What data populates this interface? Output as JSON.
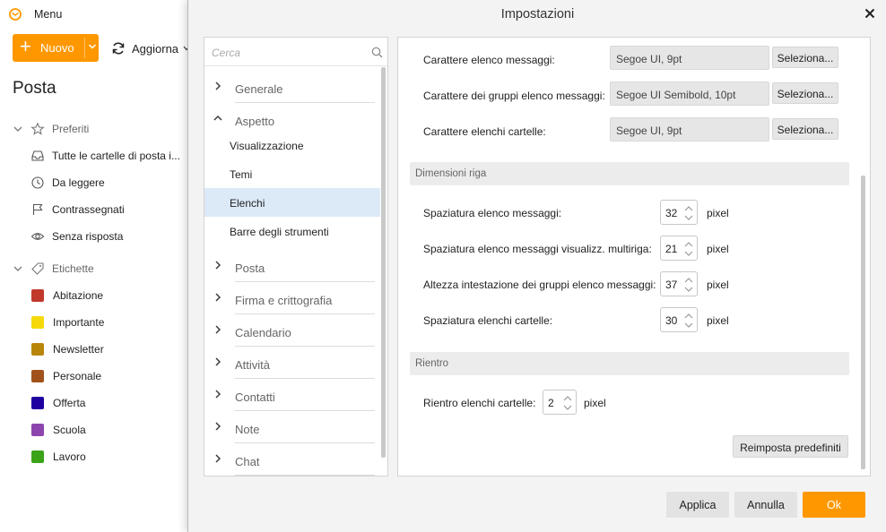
{
  "app": {
    "menu_label": "Menu",
    "nuovo_label": "Nuovo",
    "aggiorna_label": "Aggiorna",
    "title": "Posta",
    "sections": {
      "preferiti": {
        "label": "Preferiti",
        "items": [
          {
            "label": "Tutte le cartelle di posta i...",
            "icon": "inbox-icon"
          },
          {
            "label": "Da leggere",
            "icon": "clock-icon"
          },
          {
            "label": "Contrassegnati",
            "icon": "flag-icon"
          },
          {
            "label": "Senza risposta",
            "icon": "eye-icon"
          }
        ]
      },
      "etichette": {
        "label": "Etichette",
        "items": [
          {
            "label": "Abitazione",
            "color": "#c0392b"
          },
          {
            "label": "Importante",
            "color": "#f5d90a"
          },
          {
            "label": "Newsletter",
            "color": "#b8860b"
          },
          {
            "label": "Personale",
            "color": "#a0521a"
          },
          {
            "label": "Offerta",
            "color": "#1f00a0"
          },
          {
            "label": "Scuola",
            "color": "#8e44ad"
          },
          {
            "label": "Lavoro",
            "color": "#3aa317"
          }
        ]
      }
    },
    "accent_color": "#ff9800"
  },
  "dialog": {
    "title": "Impostazioni",
    "search_placeholder": "Cerca",
    "tree": {
      "generale": "Generale",
      "aspetto": "Aspetto",
      "aspetto_sub": [
        "Visualizzazione",
        "Temi",
        "Elenchi",
        "Barre degli strumenti"
      ],
      "selected_sub": "Elenchi",
      "groups_after": [
        "Posta",
        "Firma e crittografia",
        "Calendario",
        "Attività",
        "Contatti",
        "Note",
        "Chat"
      ]
    },
    "fonts": {
      "rows": [
        {
          "label": "Carattere elenco messaggi:",
          "value": "Segoe UI, 9pt",
          "button": "Seleziona..."
        },
        {
          "label": "Carattere dei gruppi elenco messaggi:",
          "value": "Segoe UI Semibold, 10pt",
          "button": "Seleziona..."
        },
        {
          "label": "Carattere elenchi cartelle:",
          "value": "Segoe UI, 9pt",
          "button": "Seleziona..."
        }
      ]
    },
    "row_sizes": {
      "header": "Dimensioni riga",
      "rows": [
        {
          "label": "Spaziatura elenco messaggi:",
          "value": "32",
          "unit": "pixel"
        },
        {
          "label": "Spaziatura elenco messaggi visualizz. multiriga:",
          "value": "21",
          "unit": "pixel"
        },
        {
          "label": "Altezza intestazione dei gruppi elenco messaggi:",
          "value": "37",
          "unit": "pixel"
        },
        {
          "label": "Spaziatura elenchi cartelle:",
          "value": "30",
          "unit": "pixel"
        }
      ]
    },
    "indent": {
      "header": "Rientro",
      "label": "Rientro elenchi cartelle:",
      "value": "2",
      "unit": "pixel"
    },
    "reset_label": "Reimposta predefiniti",
    "footer": {
      "applica": "Applica",
      "annulla": "Annulla",
      "ok": "Ok"
    }
  }
}
